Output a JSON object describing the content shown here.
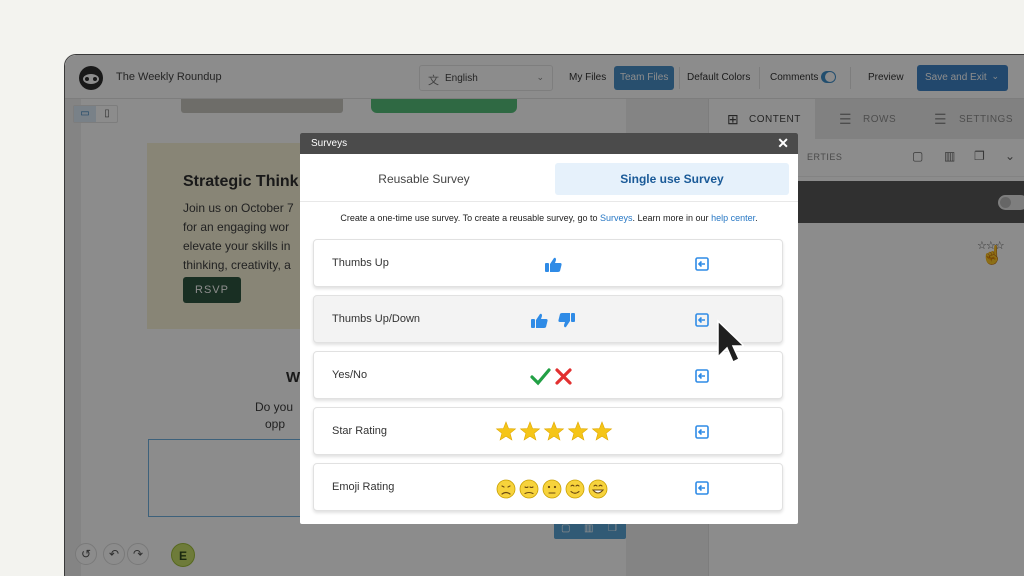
{
  "app": {
    "title": "The Weekly Roundup",
    "language": "English",
    "toolbar": {
      "my_files": "My Files",
      "team_files": "Team Files",
      "default_colors": "Default Colors",
      "comments": "Comments",
      "preview": "Preview",
      "save_exit": "Save and Exit"
    }
  },
  "canvas": {
    "event_title": "Strategic Think",
    "event_body": "Join us on October 7\nfor an engaging wor\nelevate your skills in\nthinking, creativity, a",
    "rsvp": "RSVP",
    "section2_title": "W",
    "section2_body": "Do you\n   opp",
    "avatar_initial": "E"
  },
  "right_panel": {
    "tabs": [
      "CONTENT",
      "ROWS",
      "SETTINGS"
    ],
    "properties_label": "ERTIES"
  },
  "modal": {
    "title": "Surveys",
    "tabs": {
      "reusable": "Reusable Survey",
      "single": "Single use Survey"
    },
    "description": {
      "prefix": "Create a one-time use survey. To create a reusable survey, go to ",
      "surveys_link": "Surveys",
      "middle": ". Learn more in our ",
      "help_link": "help center",
      "suffix": "."
    },
    "rows": [
      {
        "label": "Thumbs Up",
        "icons": "thumbs-up"
      },
      {
        "label": "Thumbs Up/Down",
        "icons": "thumbs-up-down"
      },
      {
        "label": "Yes/No",
        "icons": "check-cross"
      },
      {
        "label": "Star Rating",
        "icons": "stars"
      },
      {
        "label": "Emoji Rating",
        "icons": "emojis"
      }
    ]
  },
  "colors": {
    "accent": "#3f84c6",
    "thumb": "#2f8be6",
    "check": "#22a045",
    "cross": "#e23030",
    "star": "#f5c518",
    "emoji": "#f7d33c"
  }
}
